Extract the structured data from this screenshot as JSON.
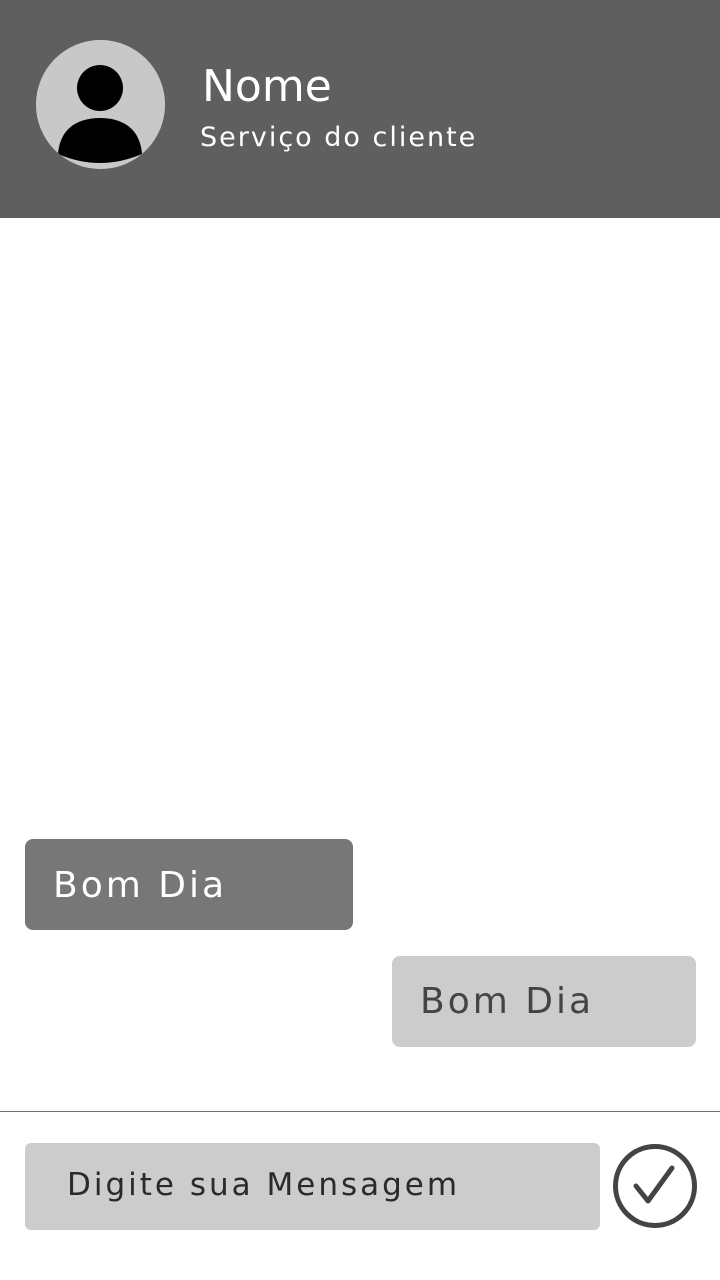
{
  "header": {
    "contact_name": "Nome",
    "contact_subtitle": "Serviço do cliente",
    "avatar_icon": "user-avatar-icon"
  },
  "messages": [
    {
      "direction": "incoming",
      "text": "Bom Dia"
    },
    {
      "direction": "outgoing",
      "text": "Bom Dia"
    }
  ],
  "composer": {
    "placeholder": "Digite sua Mensagem",
    "send_icon": "check-circle-icon"
  },
  "colors": {
    "header_bg": "#5f5f5f",
    "incoming_bubble": "#777777",
    "outgoing_bubble": "#cccccc",
    "input_bg": "#cccccc",
    "send_icon": "#444444"
  }
}
